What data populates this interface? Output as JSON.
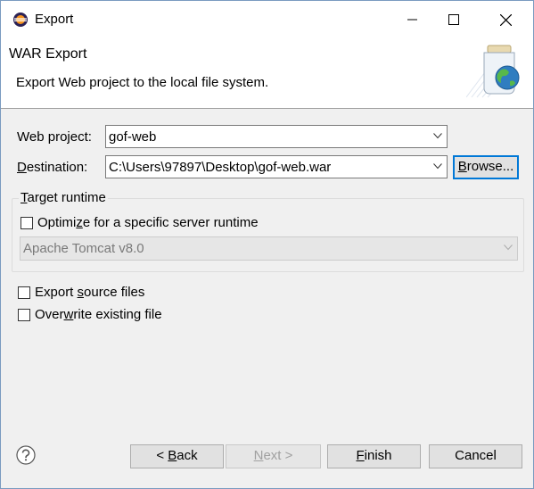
{
  "window": {
    "title": "Export",
    "icon": "eclipse-icon"
  },
  "banner": {
    "title": "WAR Export",
    "description": "Export Web project to the local file system.",
    "icon": "export-jar-globe-icon"
  },
  "form": {
    "web_project": {
      "label_pre": "Web pro",
      "label_ul": "j",
      "label_post": "ect:",
      "value": "gof-web"
    },
    "destination": {
      "label_pre": "",
      "label_ul": "D",
      "label_post": "estination:",
      "value": "C:\\Users\\97897\\Desktop\\gof-web.war"
    },
    "browse": {
      "pre": "",
      "ul": "B",
      "post": "rowse..."
    }
  },
  "target_runtime": {
    "label_pre": "",
    "label_ul": "T",
    "label_post": "arget runtime",
    "optimize": {
      "pre": "Optimi",
      "ul": "z",
      "post": "e for a specific server runtime",
      "checked": false
    },
    "server": "Apache Tomcat v8.0"
  },
  "options": {
    "export_source": {
      "pre": "Export ",
      "ul": "s",
      "post": "ource files",
      "checked": false
    },
    "overwrite": {
      "pre": "Over",
      "ul": "w",
      "post": "rite existing file",
      "checked": false
    }
  },
  "buttons": {
    "back": {
      "pre": "< ",
      "ul": "B",
      "post": "ack"
    },
    "next": {
      "pre": "",
      "ul": "N",
      "post": "ext >"
    },
    "finish": {
      "pre": "",
      "ul": "F",
      "post": "inish"
    },
    "cancel": "Cancel"
  },
  "colors": {
    "focus": "#0078d7",
    "dialog_bg": "#f0f0f0"
  }
}
